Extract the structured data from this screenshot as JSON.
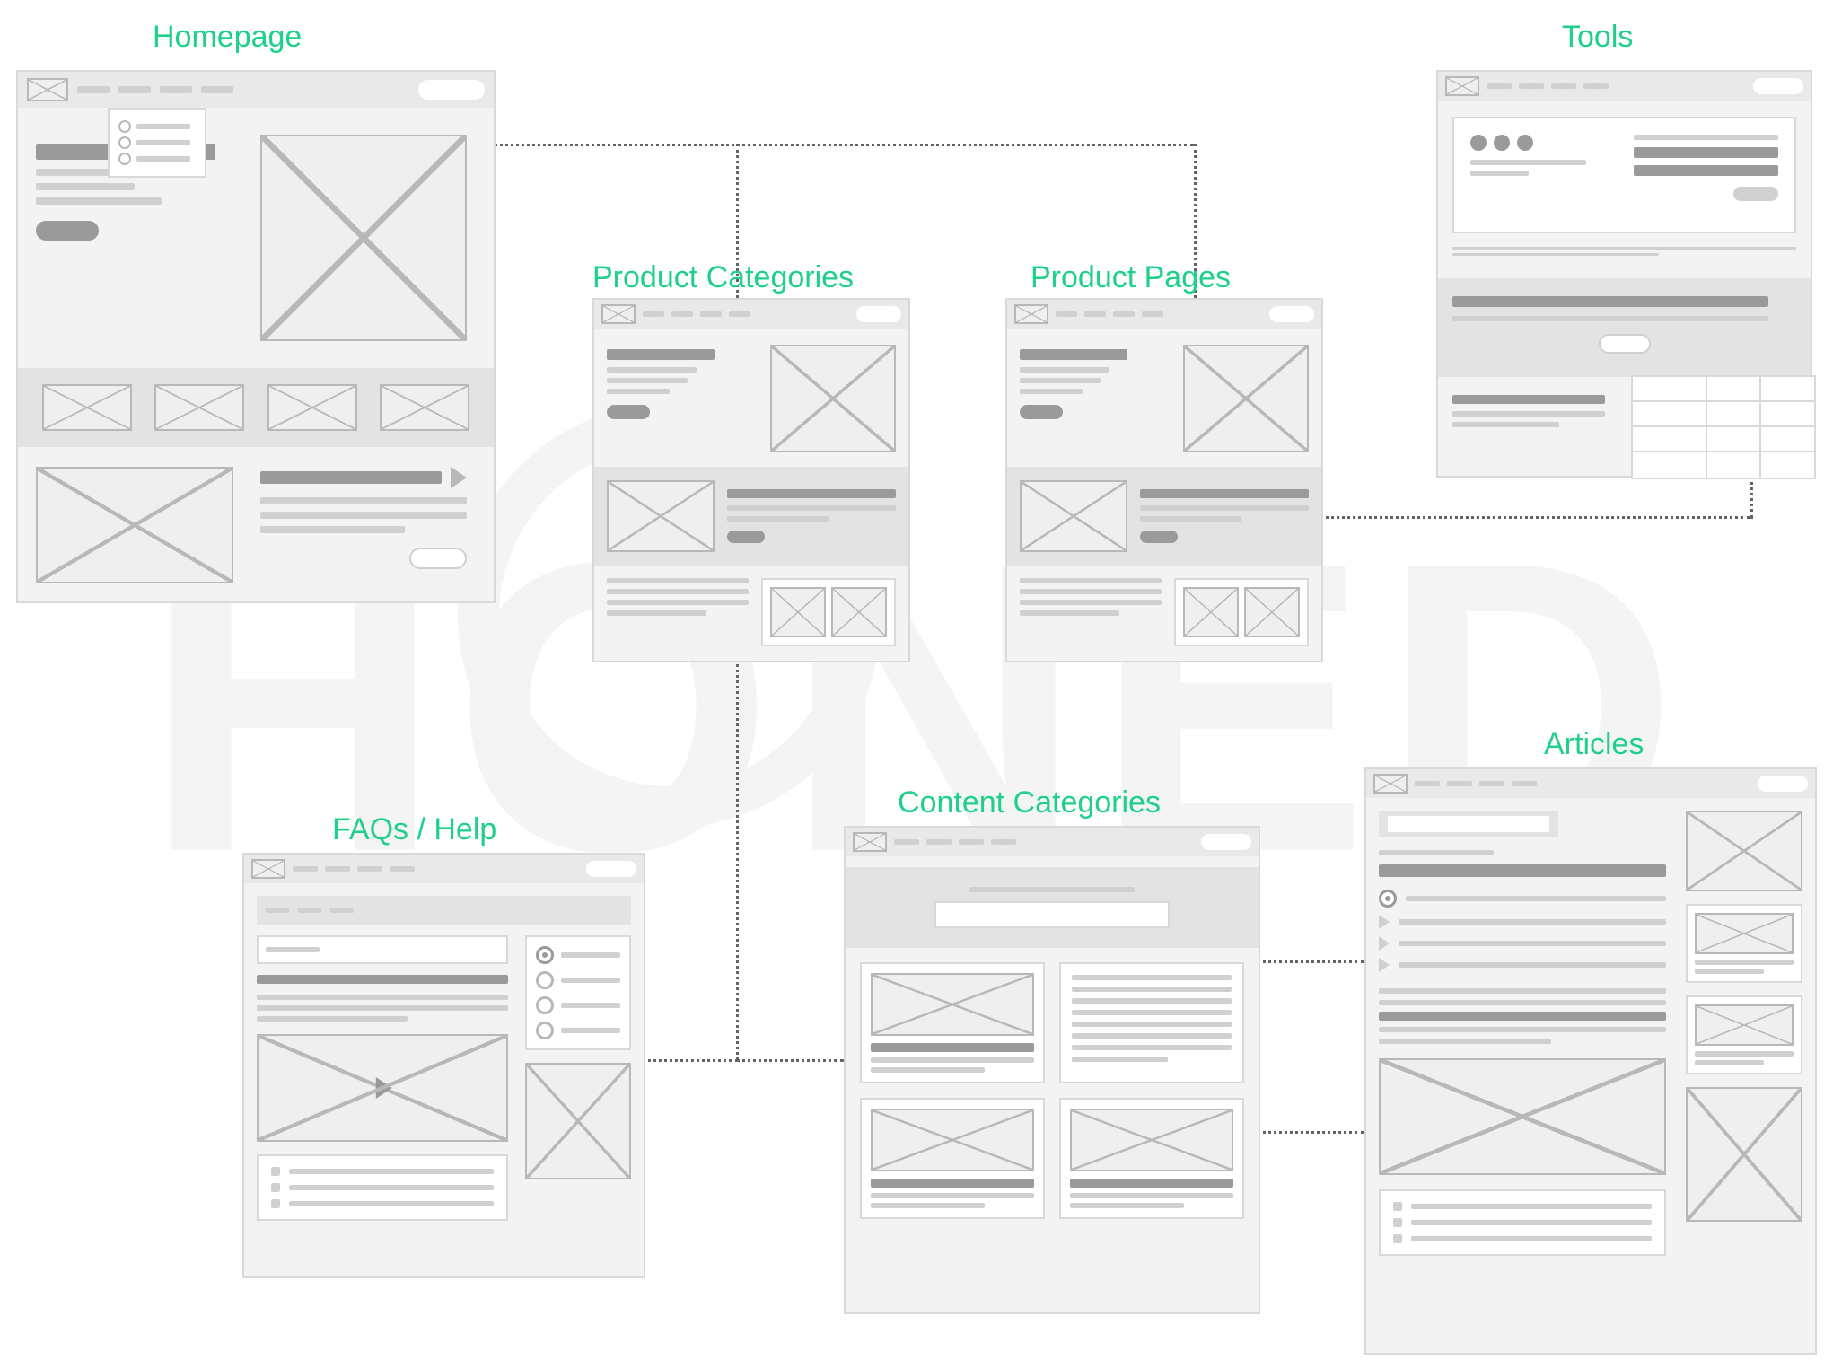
{
  "labels": {
    "homepage": "Homepage",
    "tools": "Tools",
    "product_categories": "Product Categories",
    "product_pages": "Product Pages",
    "faqs_help": "FAQs / Help",
    "content_categories": "Content Categories",
    "articles": "Articles"
  },
  "watermark": "HONED"
}
